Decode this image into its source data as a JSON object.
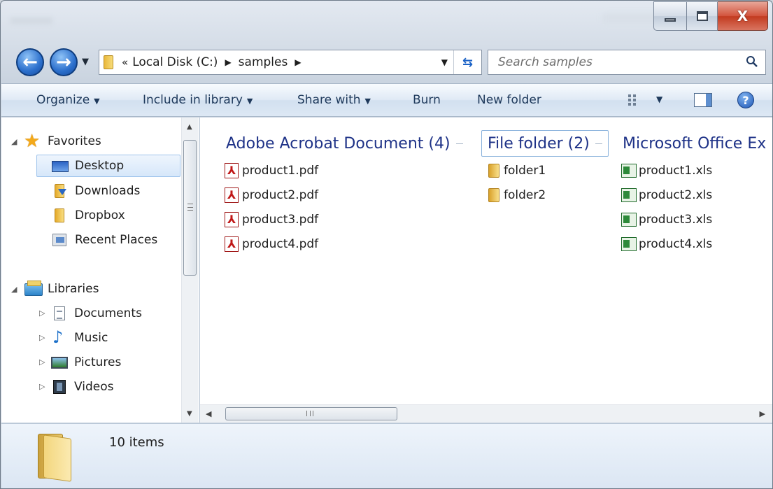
{
  "window": {
    "caption_buttons": [
      "minimize",
      "maximize",
      "close"
    ]
  },
  "nav": {
    "breadcrumb_prefix": "«",
    "breadcrumbs": [
      "Local Disk (C:)",
      "samples"
    ],
    "search_placeholder": "Search samples"
  },
  "commands": {
    "organize": "Organize",
    "include_in_library": "Include in library",
    "share_with": "Share with",
    "burn": "Burn",
    "new_folder": "New folder"
  },
  "sidebar": {
    "favorites": {
      "label": "Favorites",
      "items": [
        "Desktop",
        "Downloads",
        "Dropbox",
        "Recent Places"
      ],
      "selected": "Desktop"
    },
    "libraries": {
      "label": "Libraries",
      "items": [
        "Documents",
        "Music",
        "Pictures",
        "Videos"
      ]
    }
  },
  "groups": [
    {
      "header": "Adobe Acrobat Document (4)",
      "icon": "pdf-icon",
      "files": [
        "product1.pdf",
        "product2.pdf",
        "product3.pdf",
        "product4.pdf"
      ]
    },
    {
      "header": "File folder (2)",
      "icon": "folder-icon",
      "files": [
        "folder1",
        "folder2"
      ]
    },
    {
      "header": "Microsoft Office Ex",
      "icon": "excel-icon",
      "files": [
        "product1.xls",
        "product2.xls",
        "product3.xls",
        "product4.xls"
      ]
    }
  ],
  "details": {
    "item_count": "10 items"
  },
  "colors": {
    "group_header": "#1e3287",
    "command_text": "#1e395b",
    "selection_border": "#9fc4ec"
  }
}
